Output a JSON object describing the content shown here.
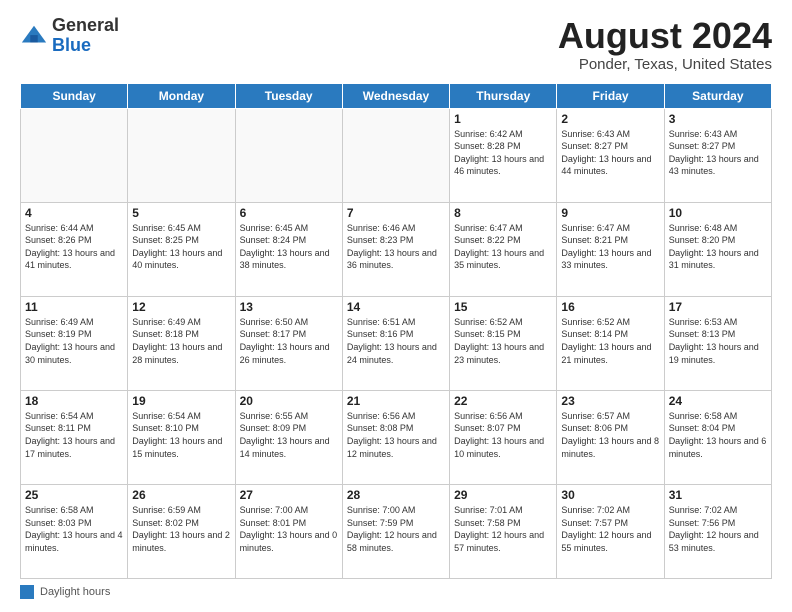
{
  "logo": {
    "general": "General",
    "blue": "Blue"
  },
  "header": {
    "title": "August 2024",
    "subtitle": "Ponder, Texas, United States"
  },
  "weekdays": [
    "Sunday",
    "Monday",
    "Tuesday",
    "Wednesday",
    "Thursday",
    "Friday",
    "Saturday"
  ],
  "weeks": [
    [
      {
        "day": "",
        "sunrise": "",
        "sunset": "",
        "daylight": ""
      },
      {
        "day": "",
        "sunrise": "",
        "sunset": "",
        "daylight": ""
      },
      {
        "day": "",
        "sunrise": "",
        "sunset": "",
        "daylight": ""
      },
      {
        "day": "",
        "sunrise": "",
        "sunset": "",
        "daylight": ""
      },
      {
        "day": "1",
        "sunrise": "Sunrise: 6:42 AM",
        "sunset": "Sunset: 8:28 PM",
        "daylight": "Daylight: 13 hours and 46 minutes."
      },
      {
        "day": "2",
        "sunrise": "Sunrise: 6:43 AM",
        "sunset": "Sunset: 8:27 PM",
        "daylight": "Daylight: 13 hours and 44 minutes."
      },
      {
        "day": "3",
        "sunrise": "Sunrise: 6:43 AM",
        "sunset": "Sunset: 8:27 PM",
        "daylight": "Daylight: 13 hours and 43 minutes."
      }
    ],
    [
      {
        "day": "4",
        "sunrise": "Sunrise: 6:44 AM",
        "sunset": "Sunset: 8:26 PM",
        "daylight": "Daylight: 13 hours and 41 minutes."
      },
      {
        "day": "5",
        "sunrise": "Sunrise: 6:45 AM",
        "sunset": "Sunset: 8:25 PM",
        "daylight": "Daylight: 13 hours and 40 minutes."
      },
      {
        "day": "6",
        "sunrise": "Sunrise: 6:45 AM",
        "sunset": "Sunset: 8:24 PM",
        "daylight": "Daylight: 13 hours and 38 minutes."
      },
      {
        "day": "7",
        "sunrise": "Sunrise: 6:46 AM",
        "sunset": "Sunset: 8:23 PM",
        "daylight": "Daylight: 13 hours and 36 minutes."
      },
      {
        "day": "8",
        "sunrise": "Sunrise: 6:47 AM",
        "sunset": "Sunset: 8:22 PM",
        "daylight": "Daylight: 13 hours and 35 minutes."
      },
      {
        "day": "9",
        "sunrise": "Sunrise: 6:47 AM",
        "sunset": "Sunset: 8:21 PM",
        "daylight": "Daylight: 13 hours and 33 minutes."
      },
      {
        "day": "10",
        "sunrise": "Sunrise: 6:48 AM",
        "sunset": "Sunset: 8:20 PM",
        "daylight": "Daylight: 13 hours and 31 minutes."
      }
    ],
    [
      {
        "day": "11",
        "sunrise": "Sunrise: 6:49 AM",
        "sunset": "Sunset: 8:19 PM",
        "daylight": "Daylight: 13 hours and 30 minutes."
      },
      {
        "day": "12",
        "sunrise": "Sunrise: 6:49 AM",
        "sunset": "Sunset: 8:18 PM",
        "daylight": "Daylight: 13 hours and 28 minutes."
      },
      {
        "day": "13",
        "sunrise": "Sunrise: 6:50 AM",
        "sunset": "Sunset: 8:17 PM",
        "daylight": "Daylight: 13 hours and 26 minutes."
      },
      {
        "day": "14",
        "sunrise": "Sunrise: 6:51 AM",
        "sunset": "Sunset: 8:16 PM",
        "daylight": "Daylight: 13 hours and 24 minutes."
      },
      {
        "day": "15",
        "sunrise": "Sunrise: 6:52 AM",
        "sunset": "Sunset: 8:15 PM",
        "daylight": "Daylight: 13 hours and 23 minutes."
      },
      {
        "day": "16",
        "sunrise": "Sunrise: 6:52 AM",
        "sunset": "Sunset: 8:14 PM",
        "daylight": "Daylight: 13 hours and 21 minutes."
      },
      {
        "day": "17",
        "sunrise": "Sunrise: 6:53 AM",
        "sunset": "Sunset: 8:13 PM",
        "daylight": "Daylight: 13 hours and 19 minutes."
      }
    ],
    [
      {
        "day": "18",
        "sunrise": "Sunrise: 6:54 AM",
        "sunset": "Sunset: 8:11 PM",
        "daylight": "Daylight: 13 hours and 17 minutes."
      },
      {
        "day": "19",
        "sunrise": "Sunrise: 6:54 AM",
        "sunset": "Sunset: 8:10 PM",
        "daylight": "Daylight: 13 hours and 15 minutes."
      },
      {
        "day": "20",
        "sunrise": "Sunrise: 6:55 AM",
        "sunset": "Sunset: 8:09 PM",
        "daylight": "Daylight: 13 hours and 14 minutes."
      },
      {
        "day": "21",
        "sunrise": "Sunrise: 6:56 AM",
        "sunset": "Sunset: 8:08 PM",
        "daylight": "Daylight: 13 hours and 12 minutes."
      },
      {
        "day": "22",
        "sunrise": "Sunrise: 6:56 AM",
        "sunset": "Sunset: 8:07 PM",
        "daylight": "Daylight: 13 hours and 10 minutes."
      },
      {
        "day": "23",
        "sunrise": "Sunrise: 6:57 AM",
        "sunset": "Sunset: 8:06 PM",
        "daylight": "Daylight: 13 hours and 8 minutes."
      },
      {
        "day": "24",
        "sunrise": "Sunrise: 6:58 AM",
        "sunset": "Sunset: 8:04 PM",
        "daylight": "Daylight: 13 hours and 6 minutes."
      }
    ],
    [
      {
        "day": "25",
        "sunrise": "Sunrise: 6:58 AM",
        "sunset": "Sunset: 8:03 PM",
        "daylight": "Daylight: 13 hours and 4 minutes."
      },
      {
        "day": "26",
        "sunrise": "Sunrise: 6:59 AM",
        "sunset": "Sunset: 8:02 PM",
        "daylight": "Daylight: 13 hours and 2 minutes."
      },
      {
        "day": "27",
        "sunrise": "Sunrise: 7:00 AM",
        "sunset": "Sunset: 8:01 PM",
        "daylight": "Daylight: 13 hours and 0 minutes."
      },
      {
        "day": "28",
        "sunrise": "Sunrise: 7:00 AM",
        "sunset": "Sunset: 7:59 PM",
        "daylight": "Daylight: 12 hours and 58 minutes."
      },
      {
        "day": "29",
        "sunrise": "Sunrise: 7:01 AM",
        "sunset": "Sunset: 7:58 PM",
        "daylight": "Daylight: 12 hours and 57 minutes."
      },
      {
        "day": "30",
        "sunrise": "Sunrise: 7:02 AM",
        "sunset": "Sunset: 7:57 PM",
        "daylight": "Daylight: 12 hours and 55 minutes."
      },
      {
        "day": "31",
        "sunrise": "Sunrise: 7:02 AM",
        "sunset": "Sunset: 7:56 PM",
        "daylight": "Daylight: 12 hours and 53 minutes."
      }
    ]
  ],
  "footer": {
    "label": "Daylight hours"
  }
}
